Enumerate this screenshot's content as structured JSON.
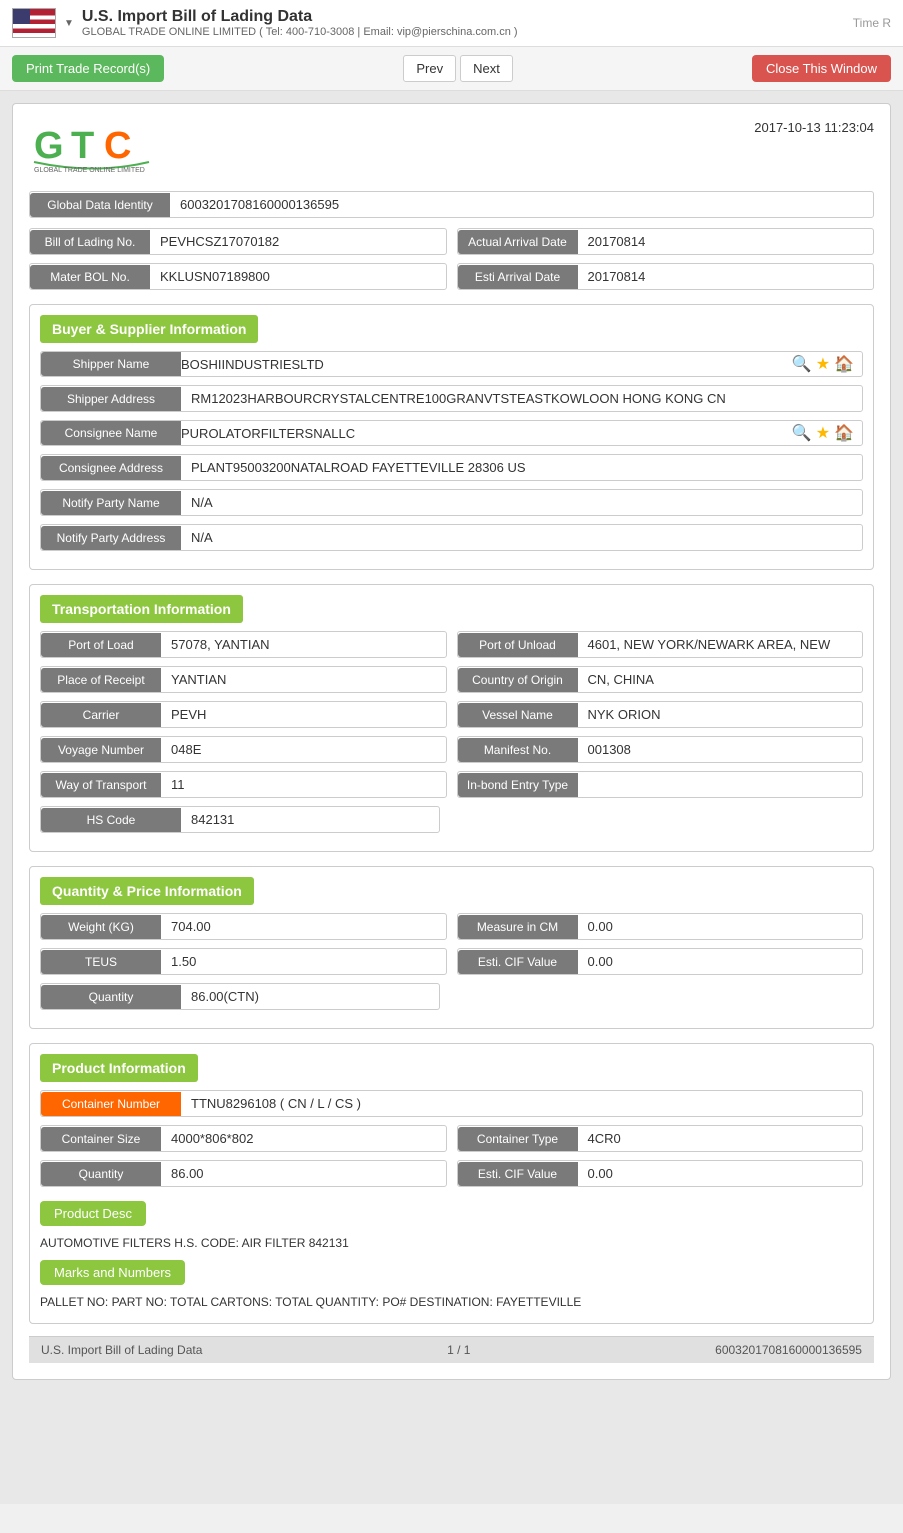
{
  "header": {
    "title": "U.S. Import Bill of Lading Data",
    "subtitle": "GLOBAL TRADE ONLINE LIMITED ( Tel: 400-710-3008 | Email: vip@pierschina.com.cn )",
    "time_label": "Time R"
  },
  "toolbar": {
    "print_label": "Print Trade Record(s)",
    "prev_label": "Prev",
    "next_label": "Next",
    "close_label": "Close This Window"
  },
  "doc": {
    "timestamp": "2017-10-13 11:23:04",
    "global_data_identity_label": "Global Data Identity",
    "global_data_identity_value": "6003201708160000136595",
    "bill_of_lading_label": "Bill of Lading No.",
    "bill_of_lading_value": "PEVHCSZ17070182",
    "actual_arrival_date_label": "Actual Arrival Date",
    "actual_arrival_date_value": "20170814",
    "master_bol_label": "Mater BOL No.",
    "master_bol_value": "KKLUSN07189800",
    "esti_arrival_label": "Esti Arrival Date",
    "esti_arrival_value": "20170814"
  },
  "buyer_supplier": {
    "section_title": "Buyer & Supplier Information",
    "shipper_name_label": "Shipper Name",
    "shipper_name_value": "BOSHIINDUSTRIESLTD",
    "shipper_address_label": "Shipper Address",
    "shipper_address_value": "RM12023HARBOURCRYSTALCENTRE100GRANVTSTEASTKOWLOON HONG KONG CN",
    "consignee_name_label": "Consignee Name",
    "consignee_name_value": "PUROLATORFILTERSNALLC",
    "consignee_address_label": "Consignee Address",
    "consignee_address_value": "PLANT95003200NATALROAD FAYETTEVILLE 28306 US",
    "notify_party_name_label": "Notify Party Name",
    "notify_party_name_value": "N/A",
    "notify_party_address_label": "Notify Party Address",
    "notify_party_address_value": "N/A"
  },
  "transportation": {
    "section_title": "Transportation Information",
    "port_of_load_label": "Port of Load",
    "port_of_load_value": "57078, YANTIAN",
    "port_of_unload_label": "Port of Unload",
    "port_of_unload_value": "4601, NEW YORK/NEWARK AREA, NEW",
    "place_of_receipt_label": "Place of Receipt",
    "place_of_receipt_value": "YANTIAN",
    "country_of_origin_label": "Country of Origin",
    "country_of_origin_value": "CN, CHINA",
    "carrier_label": "Carrier",
    "carrier_value": "PEVH",
    "vessel_name_label": "Vessel Name",
    "vessel_name_value": "NYK ORION",
    "voyage_number_label": "Voyage Number",
    "voyage_number_value": "048E",
    "manifest_no_label": "Manifest No.",
    "manifest_no_value": "001308",
    "way_of_transport_label": "Way of Transport",
    "way_of_transport_value": "11",
    "inbond_entry_label": "In-bond Entry Type",
    "inbond_entry_value": "",
    "hs_code_label": "HS Code",
    "hs_code_value": "842131"
  },
  "quantity_price": {
    "section_title": "Quantity & Price Information",
    "weight_label": "Weight (KG)",
    "weight_value": "704.00",
    "measure_cm_label": "Measure in CM",
    "measure_cm_value": "0.00",
    "teus_label": "TEUS",
    "teus_value": "1.50",
    "esti_cif_label": "Esti. CIF Value",
    "esti_cif_value": "0.00",
    "quantity_label": "Quantity",
    "quantity_value": "86.00(CTN)"
  },
  "product": {
    "section_title": "Product Information",
    "container_number_label": "Container Number",
    "container_number_value": "TTNU8296108 ( CN / L / CS )",
    "container_size_label": "Container Size",
    "container_size_value": "4000*806*802",
    "container_type_label": "Container Type",
    "container_type_value": "4CR0",
    "quantity_label": "Quantity",
    "quantity_value": "86.00",
    "esti_cif_label": "Esti. CIF Value",
    "esti_cif_value": "0.00",
    "product_desc_label": "Product Desc",
    "product_desc_text": "AUTOMOTIVE FILTERS H.S. CODE: AIR FILTER 842131",
    "marks_label": "Marks and Numbers",
    "marks_text": "PALLET NO: PART NO: TOTAL CARTONS: TOTAL QUANTITY: PO# DESTINATION: FAYETTEVILLE"
  },
  "footer": {
    "doc_type": "U.S. Import Bill of Lading Data",
    "page_info": "1 / 1",
    "record_id": "6003201708160000136595"
  }
}
